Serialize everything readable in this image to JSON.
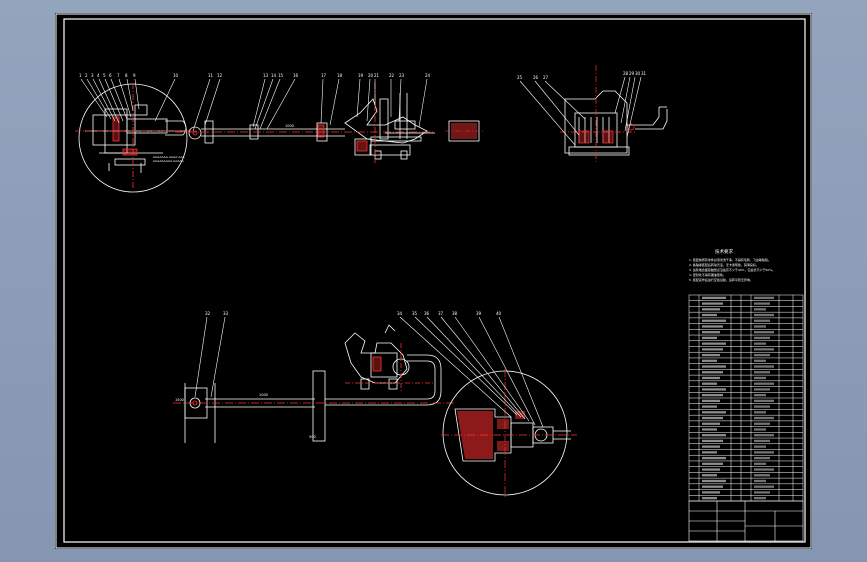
{
  "viewport": {
    "background_top": "#93a4bd",
    "background_bottom": "#8596b2"
  },
  "sheet": {
    "background": "#000000",
    "frame_color": "#ffffff",
    "dim_color": "#ff2a2a",
    "note_title": "技术要求",
    "parts_rows": 36
  }
}
